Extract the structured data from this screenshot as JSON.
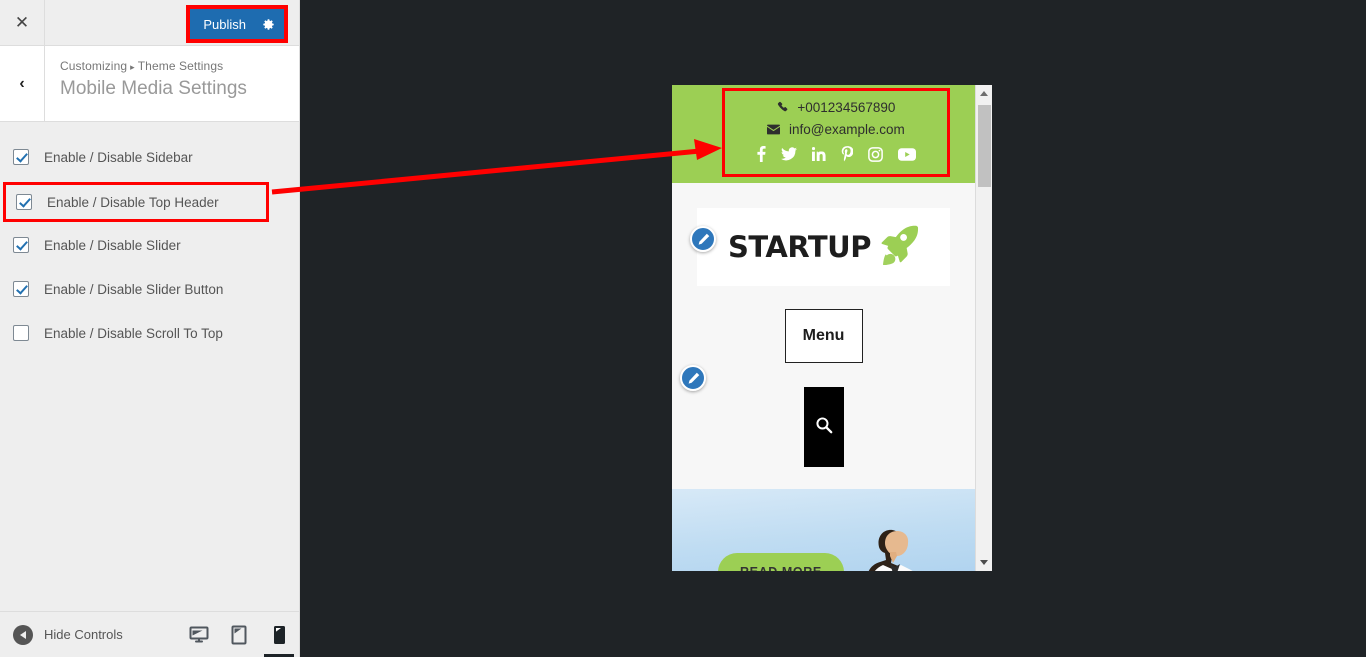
{
  "customizer": {
    "close_label": "✕",
    "back_label": "‹",
    "publish": {
      "label": "Publish",
      "gear_icon": "gear-icon"
    },
    "breadcrumb": {
      "root": "Customizing",
      "separator": "▸",
      "section": "Theme Settings"
    },
    "heading": "Mobile Media Settings",
    "options": [
      {
        "label": "Enable / Disable Sidebar",
        "checked": true,
        "highlighted": false
      },
      {
        "label": "Enable / Disable Top Header",
        "checked": true,
        "highlighted": true
      },
      {
        "label": "Enable / Disable Slider",
        "checked": true,
        "highlighted": false
      },
      {
        "label": "Enable / Disable Slider Button",
        "checked": true,
        "highlighted": false
      },
      {
        "label": "Enable / Disable Scroll To Top",
        "checked": false,
        "highlighted": false
      }
    ],
    "footer": {
      "hide_controls_label": "Hide Controls",
      "devices": [
        {
          "name": "desktop",
          "active": false
        },
        {
          "name": "tablet",
          "active": false
        },
        {
          "name": "mobile",
          "active": true
        }
      ]
    }
  },
  "preview": {
    "topbar": {
      "phone": "+001234567890",
      "email": "info@example.com",
      "phone_icon": "phone-icon",
      "email_icon": "envelope-icon",
      "social": [
        "facebook",
        "twitter",
        "linkedin",
        "pinterest",
        "instagram",
        "youtube"
      ],
      "background_color": "#9ccf54"
    },
    "logo": {
      "text": "STARTUP",
      "icon": "rocket-icon"
    },
    "menu_button": "Menu",
    "search_icon": "search-icon",
    "slider": {
      "button_label": "READ MORE",
      "button_color": "#9ccf54"
    },
    "edit_shortcuts": [
      "edit-pencil-logo",
      "edit-pencil-search"
    ]
  },
  "annotations": {
    "highlight_color": "#ff0000",
    "arrow": "points from Top Header checkbox to preview top header"
  }
}
